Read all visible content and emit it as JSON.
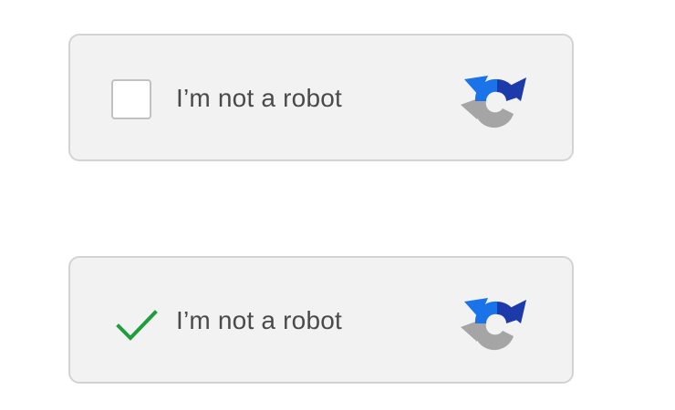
{
  "captchas": [
    {
      "state": "unchecked",
      "checked": false,
      "label": "I’m not a robot",
      "logo_icon": "recaptcha-logo-icon"
    },
    {
      "state": "checked",
      "checked": true,
      "label": "I’m not a robot",
      "logo_icon": "recaptcha-logo-icon",
      "check_icon": "checkmark-icon"
    }
  ],
  "colors": {
    "widget_background": "#f2f2f2",
    "widget_border": "#d3d3d3",
    "checkbox_border": "#c1c1c1",
    "label_text": "#4a4a4a",
    "check_green": "#1e9e3a",
    "logo_light_blue": "#1a73e8",
    "logo_dark_blue": "#1c3aa9",
    "logo_gray": "#a5a5a5"
  }
}
